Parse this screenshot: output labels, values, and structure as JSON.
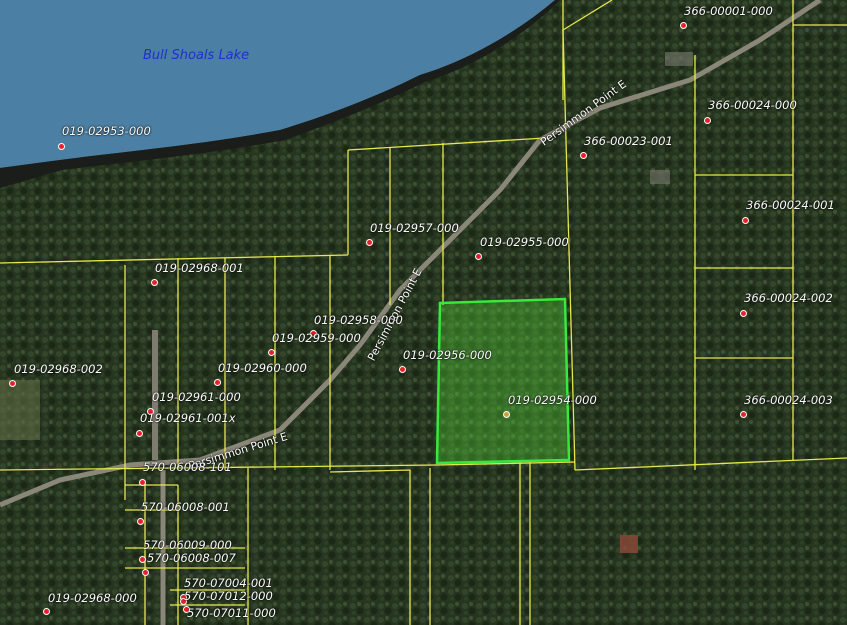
{
  "map": {
    "lake_label": "Bull Shoals Lake",
    "roads": [
      {
        "name": "Persimmon Point E"
      },
      {
        "name": "Persimmon Point E"
      },
      {
        "name": "Persimmon Point E"
      }
    ],
    "selected_parcel": "019-02954-000",
    "colors": {
      "parcel_line": "#e6e84a",
      "selected_outline": "#39e83c",
      "point": "#e8202a",
      "water": "#4b7fa3",
      "lake_label": "#1f2fd0"
    },
    "parcels": [
      "366-00001-000",
      "366-00024-000",
      "366-00023-001",
      "366-00024-001",
      "366-00024-002",
      "366-00024-003",
      "019-02953-000",
      "019-02957-000",
      "019-02955-000",
      "019-02968-001",
      "019-02958-000",
      "019-02959-000",
      "019-02956-000",
      "019-02960-000",
      "019-02968-002",
      "019-02961-000",
      "019-02961-001x",
      "019-02954-000",
      "570-06008-101",
      "570-06008-001",
      "570-06009-000",
      "570-06008-007",
      "570-07004-001",
      "570-07012-000",
      "570-07011-000",
      "019-02968-000"
    ]
  }
}
